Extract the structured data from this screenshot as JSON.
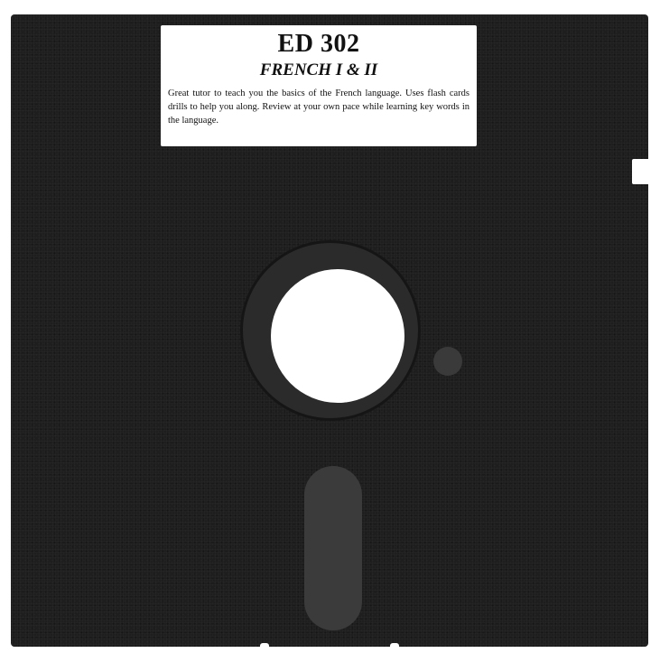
{
  "label": {
    "code": "ED 302",
    "title": "FRENCH I & II",
    "description": "Great tutor to teach you the basics of the French language.  Uses flash cards drills to help you along.  Review at your own pace while learning key words in the language."
  },
  "colors": {
    "disk_body": "#1e1e1e",
    "hub_ring": "#2b2b2b",
    "read_window": "#3b3b3b",
    "label_background": "#ffffff",
    "label_text": "#111111"
  }
}
